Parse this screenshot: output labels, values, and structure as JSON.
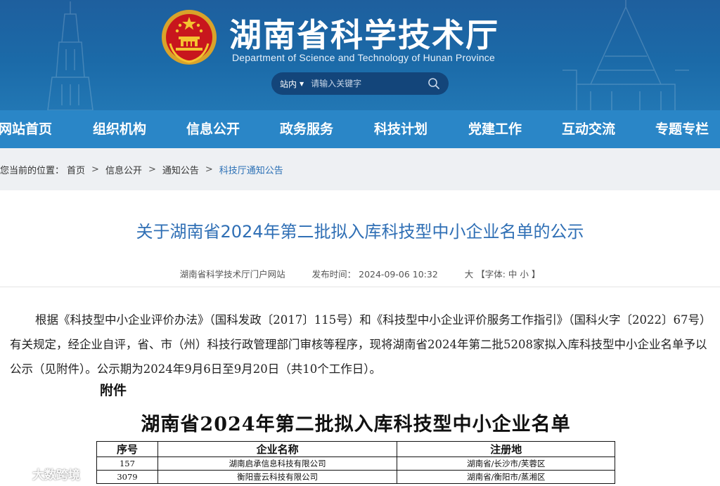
{
  "header": {
    "site_title": "湖南省科学技术厅",
    "site_subtitle": "Department of Science and Technology of Hunan Province",
    "search": {
      "scope_label": "站内",
      "placeholder": "请输入关键字"
    }
  },
  "nav": {
    "items": [
      {
        "label": "网站首页"
      },
      {
        "label": "组织机构"
      },
      {
        "label": "信息公开"
      },
      {
        "label": "政务服务"
      },
      {
        "label": "科技计划"
      },
      {
        "label": "党建工作"
      },
      {
        "label": "互动交流"
      },
      {
        "label": "专题专栏"
      }
    ]
  },
  "breadcrumb": {
    "prefix": "您当前的位置：",
    "items": [
      "首页",
      "信息公开",
      "通知公告",
      "科技厅通知公告"
    ],
    "separator": ">"
  },
  "article": {
    "title": "关于湖南省2024年第二批拟入库科技型中小企业名单的公示",
    "source": "湖南省科学技术厅门户网站",
    "publish_label": "发布时间：",
    "publish_time": "2024-09-06 10:32",
    "font_size_label": "大 【字体: 中 小 】",
    "body": "根据《科技型中小企业评价办法》（国科发政〔2017〕115号）和《科技型中小企业评价服务工作指引》（国科火字〔2022〕67号）有关规定，经企业自评，省、市（州）科技行政管理部门审核等程序，现将湖南省2024年第二批5208家拟入库科技型中小企业名单予以公示（见附件）。公示期为2024年9月6日至9月20日（共10个工作日）。",
    "attachment_label": "附件",
    "list_title": "湖南省2024年第二批拟入库科技型中小企业名单",
    "table": {
      "headers": [
        "序号",
        "企业名称",
        "注册地"
      ],
      "rows": [
        [
          "157",
          "湖南启承信息科技有限公司",
          "湖南省/长沙市/芙蓉区"
        ],
        [
          "3079",
          "衡阳壹云科技有限公司",
          "湖南省/衡阳市/蒸湘区"
        ]
      ]
    }
  },
  "watermark": {
    "text": "大数跨境"
  },
  "colors": {
    "header_bg": "#1b6aa8",
    "nav_bg": "#2a86c7",
    "title_blue": "#2f6fb5",
    "crumb_bg": "#eef0f3"
  }
}
